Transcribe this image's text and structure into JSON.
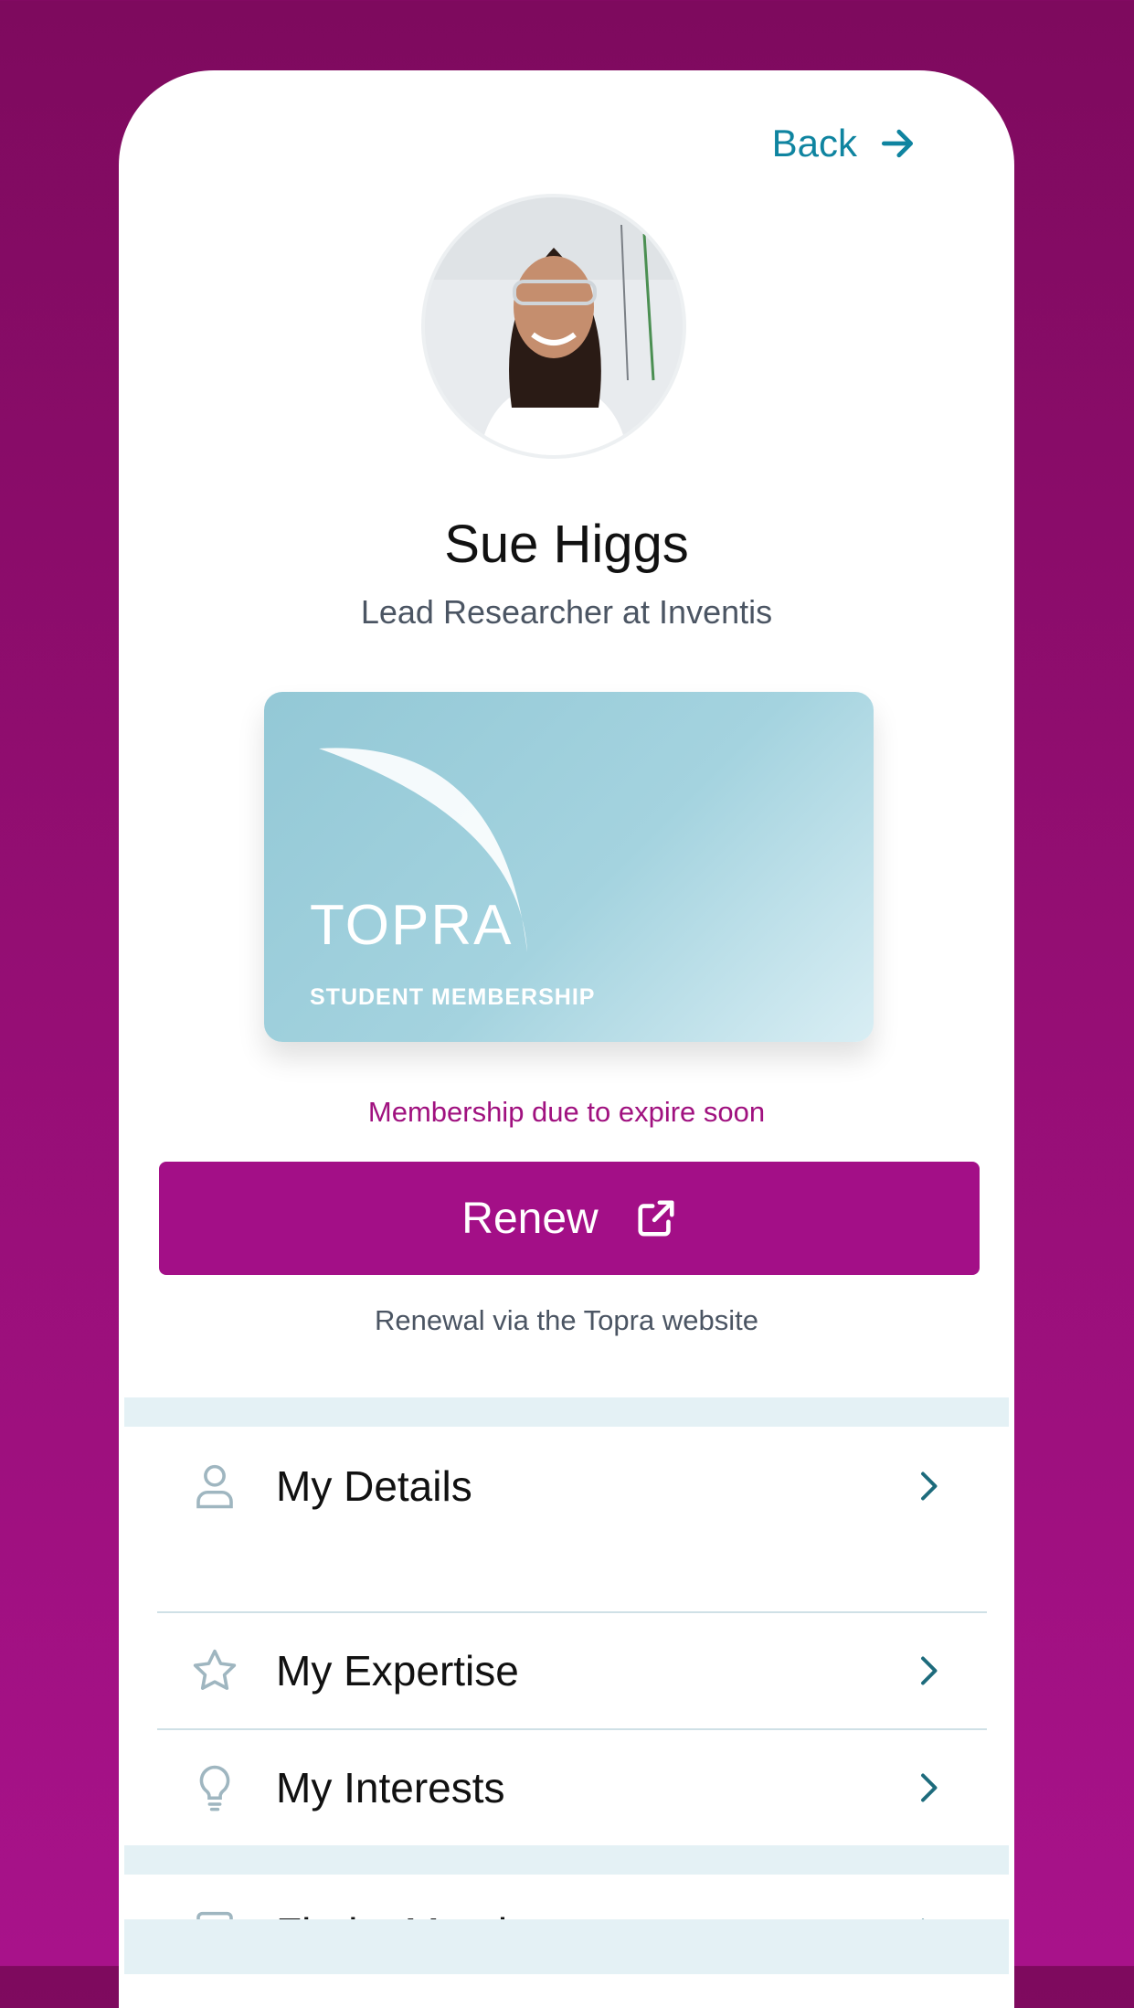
{
  "header": {
    "back_label": "Back"
  },
  "profile": {
    "name": "Sue Higgs",
    "role": "Lead Researcher at Inventis"
  },
  "card": {
    "brand": "TOPRA",
    "membership_type": "STUDENT MEMBERSHIP"
  },
  "membership": {
    "status": "Membership due to expire soon",
    "renew_label": "Renew",
    "renew_note": "Renewal via the Topra website"
  },
  "menu": {
    "details": "My Details",
    "expertise": "My Expertise",
    "interests": "My Interests",
    "find_member": "Find a Member"
  },
  "icons": {
    "back": "arrow-right-icon",
    "renew": "external-link-icon",
    "details": "user-icon",
    "expertise": "star-icon",
    "interests": "lightbulb-icon",
    "find_member": "contact-book-icon",
    "chevron": "chevron-right-icon"
  },
  "colors": {
    "accent": "#a30f87",
    "link": "#0f84a0",
    "icon_muted": "#9fb6c0",
    "chevron": "#1d6b7c",
    "band": "#e4f1f5"
  }
}
